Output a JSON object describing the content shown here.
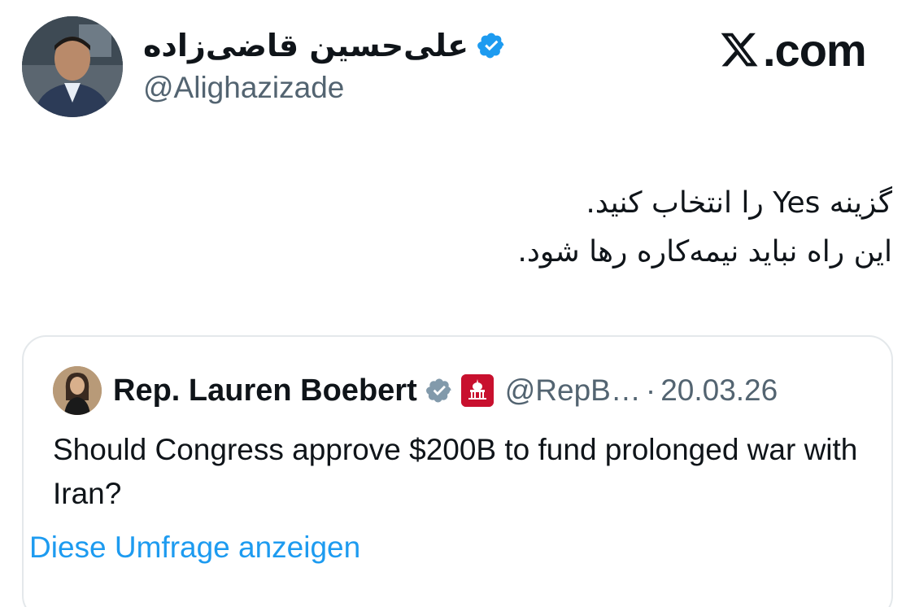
{
  "author": {
    "display_name": "علی‌حسین قاضی‌زاده",
    "handle": "@Alighazizade",
    "verified": true,
    "avatar_icon": "person-avatar"
  },
  "site": {
    "label": ".com",
    "icon": "x-logo-icon"
  },
  "tweet": {
    "lines": [
      "گزینه Yes را انتخاب کنید.",
      "این راه نباید نیمه‌کاره رها شود."
    ]
  },
  "quote": {
    "display_name": "Rep. Lauren Boebert",
    "verified": true,
    "badge_icon": "house-gop-badge-icon",
    "handle": "@RepB…",
    "separator": "·",
    "date": "20.03.26",
    "text": "Should Congress approve $200B to fund prolonged war with Iran?",
    "poll_link": "Diese Umfrage anzeigen"
  },
  "colors": {
    "verified_blue": "#1d9bf0",
    "quote_verified_gray": "#829aab",
    "link_blue": "#1d9bf0",
    "secondary_text": "#536471",
    "badge_red": "#c8102e"
  }
}
